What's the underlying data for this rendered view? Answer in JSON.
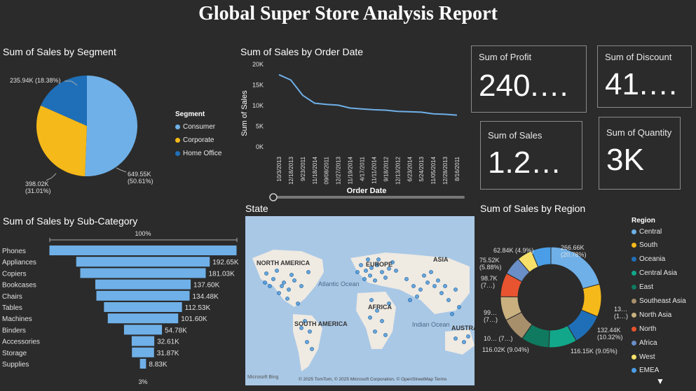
{
  "report": {
    "title": "Global Super Store Analysis Report"
  },
  "segment": {
    "title": "Sum of Sales by Segment",
    "legend_title": "Segment",
    "items": [
      {
        "name": "Consumer",
        "label": "649.55K\n(50.61%)",
        "value": 50.61,
        "color": "#6fb0e8"
      },
      {
        "name": "Corporate",
        "label": "398.02K\n(31.01%)",
        "value": 31.01,
        "color": "#f6b91a"
      },
      {
        "name": "Home Office",
        "label": "235.94K (18.38%)",
        "value": 18.38,
        "color": "#1f6fb8"
      }
    ]
  },
  "orderdate": {
    "title": "Sum of Sales by Order Date",
    "ylabel": "Sum of Sales",
    "xlabel": "Order Date",
    "yticks": [
      "20K",
      "15K",
      "10K",
      "5K",
      "0K"
    ],
    "xticks": [
      "10/3/2013",
      "12/18/2013",
      "9/23/2011",
      "11/18/2014",
      "09/08/2011",
      "12/27/2013",
      "11/19/2014",
      "4/17/2011",
      "11/11/2014",
      "9/18/2012",
      "12/13/2012",
      "6/23/2014",
      "5/24/2013",
      "11/05/2014",
      "12/28/2013",
      "8/16/2011"
    ]
  },
  "kpis": {
    "profit": {
      "label": "Sum of Profit",
      "value": "240.…"
    },
    "discount": {
      "label": "Sum of Discount",
      "value": "41.…"
    },
    "sales": {
      "label": "Sum of Sales",
      "value": "1.2…"
    },
    "quantity": {
      "label": "Sum of Quantity",
      "value": "3K"
    }
  },
  "subcategory": {
    "title": "Sum of Sales by Sub-Category",
    "top_label": "100%",
    "bottom_label": "3%",
    "items": [
      {
        "name": "Phones",
        "label": "",
        "value": 270
      },
      {
        "name": "Appliances",
        "label": "192.65K",
        "value": 192.65
      },
      {
        "name": "Copiers",
        "label": "181.03K",
        "value": 181.03
      },
      {
        "name": "Bookcases",
        "label": "137.60K",
        "value": 137.6
      },
      {
        "name": "Chairs",
        "label": "134.48K",
        "value": 134.48
      },
      {
        "name": "Tables",
        "label": "112.53K",
        "value": 112.53
      },
      {
        "name": "Machines",
        "label": "101.60K",
        "value": 101.6
      },
      {
        "name": "Binders",
        "label": "54.78K",
        "value": 54.78
      },
      {
        "name": "Accessories",
        "label": "32.61K",
        "value": 32.61
      },
      {
        "name": "Storage",
        "label": "31.87K",
        "value": 31.87
      },
      {
        "name": "Supplies",
        "label": "8.83K",
        "value": 8.83
      }
    ]
  },
  "state": {
    "title": "State",
    "labels": {
      "na": "NORTH AMERICA",
      "sa": "SOUTH AMERICA",
      "eu": "EUROPE",
      "af": "AFRICA",
      "as": "ASIA",
      "au": "AUSTRA",
      "atl": "Atlantic\nOcean",
      "ind": "Indian\nOcean"
    },
    "footer": "© 2025 TomTom, © 2025 Microsoft Corporation, © OpenStreetMap  Terms",
    "brand": "Microsoft Bing"
  },
  "region": {
    "title": "Sum of Sales by Region",
    "legend_title": "Region",
    "legend": [
      {
        "name": "Central",
        "color": "#6fb0e8"
      },
      {
        "name": "South",
        "color": "#f6b91a"
      },
      {
        "name": "Oceania",
        "color": "#1f6fb8"
      },
      {
        "name": "Central Asia",
        "color": "#12a78a"
      },
      {
        "name": "East",
        "color": "#0f7a5f"
      },
      {
        "name": "Southeast Asia",
        "color": "#a88f6c"
      },
      {
        "name": "North Asia",
        "color": "#c9b07e"
      },
      {
        "name": "North",
        "color": "#e8542f"
      },
      {
        "name": "Africa",
        "color": "#6a8ec8"
      },
      {
        "name": "West",
        "color": "#f7e06a"
      },
      {
        "name": "EMEA",
        "color": "#4a9ee8"
      }
    ],
    "slices": [
      {
        "name": "Central",
        "value": 20.78,
        "color": "#6fb0e8",
        "label": "266.66K\n(20.78%)"
      },
      {
        "name": "South",
        "value": 10.5,
        "color": "#f6b91a",
        "label": "13…\n(1…)"
      },
      {
        "name": "Oceania",
        "value": 10.32,
        "color": "#1f6fb8",
        "label": "132.44K\n(10.32%)"
      },
      {
        "name": "Central Asia",
        "value": 9.05,
        "color": "#12a78a",
        "label": "116.15K (9.05%)"
      },
      {
        "name": "East",
        "value": 9.04,
        "color": "#0f7a5f",
        "label": "116.02K (9.04%)"
      },
      {
        "name": "Southeast Asia",
        "value": 7.8,
        "color": "#a88f6c",
        "label": "10… (7…)"
      },
      {
        "name": "North Asia",
        "value": 7.7,
        "color": "#c9b07e",
        "label": "99…\n(7…)"
      },
      {
        "name": "North",
        "value": 7.7,
        "color": "#e8542f",
        "label": "98.7K\n(7…)"
      },
      {
        "name": "Africa",
        "value": 5.88,
        "color": "#6a8ec8",
        "label": "75.52K\n(5.88%)"
      },
      {
        "name": "West",
        "value": 4.9,
        "color": "#f7e06a",
        "label": "62.84K (4.9%)"
      },
      {
        "name": "EMEA",
        "value": 6.33,
        "color": "#4a9ee8",
        "label": ""
      }
    ]
  },
  "chart_data": [
    {
      "type": "pie",
      "title": "Sum of Sales by Segment",
      "categories": [
        "Consumer",
        "Corporate",
        "Home Office"
      ],
      "values": [
        649.55,
        398.02,
        235.94
      ]
    },
    {
      "type": "line",
      "title": "Sum of Sales by Order Date",
      "xlabel": "Order Date",
      "ylabel": "Sum of Sales",
      "ylim": [
        0,
        20000
      ],
      "x": [
        "10/3/2013",
        "12/18/2013",
        "9/23/2011",
        "11/18/2014",
        "09/08/2011",
        "12/27/2013",
        "11/19/2014",
        "4/17/2011",
        "11/11/2014",
        "9/18/2012",
        "12/13/2012",
        "6/23/2014",
        "5/24/2013",
        "11/05/2014",
        "12/28/2013",
        "8/16/2011"
      ],
      "values": [
        17500,
        16200,
        12500,
        10600,
        10300,
        10100,
        9400,
        9200,
        9000,
        8900,
        8600,
        8500,
        8400,
        8000,
        7900,
        7700
      ]
    },
    {
      "type": "bar",
      "title": "Sum of Sales by Sub-Category",
      "categories": [
        "Phones",
        "Appliances",
        "Copiers",
        "Bookcases",
        "Chairs",
        "Tables",
        "Machines",
        "Binders",
        "Accessories",
        "Storage",
        "Supplies"
      ],
      "values": [
        270,
        192.65,
        181.03,
        137.6,
        134.48,
        112.53,
        101.6,
        54.78,
        32.61,
        31.87,
        8.83
      ]
    },
    {
      "type": "pie",
      "title": "Sum of Sales by Region",
      "categories": [
        "Central",
        "South",
        "Oceania",
        "Central Asia",
        "East",
        "Southeast Asia",
        "North Asia",
        "North",
        "Africa",
        "West",
        "EMEA"
      ],
      "values": [
        266.66,
        135,
        132.44,
        116.15,
        116.02,
        100,
        99,
        98.7,
        75.52,
        62.84,
        81
      ]
    }
  ]
}
